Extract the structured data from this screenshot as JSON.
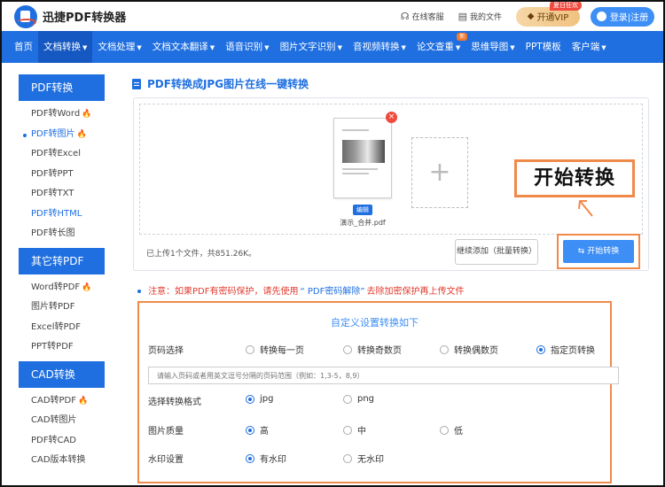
{
  "header": {
    "logo_text": "迅捷PDF转换器",
    "service_label": "在线客服",
    "files_label": "我的文件",
    "vip_label": "开通VIP",
    "vip_badge": "夏日狂欢",
    "login_label": "登录|注册"
  },
  "nav": {
    "items": [
      {
        "label": "首页",
        "dropdown": false
      },
      {
        "label": "文档转换",
        "dropdown": true,
        "active": true
      },
      {
        "label": "文档处理",
        "dropdown": true
      },
      {
        "label": "文档文本翻译",
        "dropdown": true
      },
      {
        "label": "语音识别",
        "dropdown": true
      },
      {
        "label": "图片文字识别",
        "dropdown": true
      },
      {
        "label": "音视频转换",
        "dropdown": true
      },
      {
        "label": "论文查重",
        "dropdown": true,
        "badge": "新"
      },
      {
        "label": "思维导图",
        "dropdown": true
      },
      {
        "label": "PPT模板",
        "dropdown": false
      },
      {
        "label": "客户端",
        "dropdown": true
      }
    ]
  },
  "sidebar": {
    "groups": [
      {
        "title": "PDF转换",
        "items": [
          "PDF转Word",
          "PDF转图片",
          "PDF转Excel",
          "PDF转PPT",
          "PDF转TXT",
          "PDF转HTML",
          "PDF转长图"
        ]
      },
      {
        "title": "其它转PDF",
        "items": [
          "Word转PDF",
          "图片转PDF",
          "Excel转PDF",
          "PPT转PDF"
        ]
      },
      {
        "title": "CAD转换",
        "items": [
          "CAD转PDF",
          "CAD转图片",
          "PDF转CAD",
          "CAD版本转换"
        ]
      }
    ]
  },
  "main": {
    "title": "PDF转换成JPG图片在线一键转换",
    "upload": {
      "file_name": "演示_合并.pdf",
      "edit_label": "编辑",
      "delete_glyph": "×",
      "add_glyph": "+",
      "info": "已上传1个文件，共851.26K。",
      "continue_label": "继续添加（批量转换）",
      "start_label": "开始转换",
      "callout": "开始转换"
    },
    "notice": {
      "prefix": "注意：如果PDF有密码保护，请先使用",
      "link": "“ PDF密码解除”",
      "suffix": "去除加密保护再上传文件"
    },
    "settings": {
      "title": "自定义设置转换如下",
      "page_label": "页码选择",
      "page_options": [
        "转换每一页",
        "转换奇数页",
        "转换偶数页",
        "指定页转换"
      ],
      "page_selected": 3,
      "range_placeholder": "请输入页码或者用英文逗号分隔的页码范围（例如：1,3-5，8,9）",
      "format_label": "选择转换格式",
      "format_options": [
        "jpg",
        "png"
      ],
      "format_selected": 0,
      "quality_label": "图片质量",
      "quality_options": [
        "高",
        "中",
        "低"
      ],
      "quality_selected": 0,
      "watermark_label": "水印设置",
      "watermark_options": [
        "有水印",
        "无水印"
      ],
      "watermark_selected": 0
    }
  },
  "colors": {
    "primary": "#1f6fe0",
    "button": "#3d8ef5",
    "highlight": "#f08a4b",
    "warning": "#e23b2e",
    "fire": "#f46b2a"
  }
}
